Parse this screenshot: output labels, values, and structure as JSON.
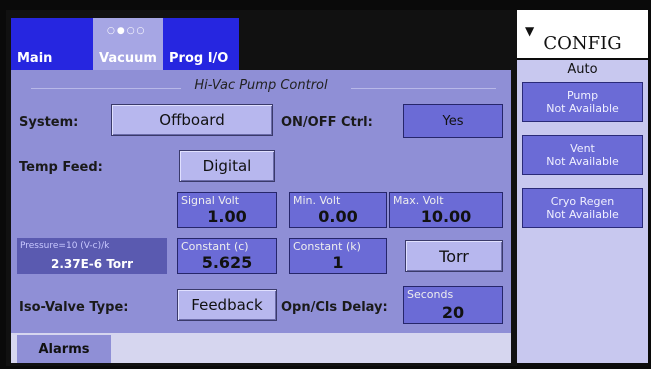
{
  "tabs": [
    {
      "label": "Main"
    },
    {
      "label": "Vacuum",
      "dots": "○●○○"
    },
    {
      "label": "Prog I/O"
    }
  ],
  "section_title": "Hi-Vac Pump Control",
  "system": {
    "label": "System:",
    "value": "Offboard"
  },
  "onoff": {
    "label": "ON/OFF Ctrl:",
    "value": "Yes"
  },
  "temp_feed": {
    "label": "Temp Feed:",
    "value": "Digital"
  },
  "signal_volt": {
    "caption": "Signal Volt",
    "value": "1.00"
  },
  "min_volt": {
    "caption": "Min. Volt",
    "value": "0.00"
  },
  "max_volt": {
    "caption": "Max. Volt",
    "value": "10.00"
  },
  "pressure": {
    "formula": "Pressure=10 (V-c)/k",
    "value": "2.37E-6 Torr"
  },
  "constant_c": {
    "caption": "Constant (c)",
    "value": "5.625"
  },
  "constant_k": {
    "caption": "Constant (k)",
    "value": "1"
  },
  "units": {
    "value": "Torr"
  },
  "iso_valve": {
    "label": "Iso-Valve Type:",
    "value": "Feedback"
  },
  "delay": {
    "label": "Opn/Cls Delay:",
    "caption": "Seconds",
    "value": "20"
  },
  "bottom": {
    "alarms": "Alarms"
  },
  "sidebar": {
    "config": "CONFIG",
    "auto": "Auto",
    "items": [
      {
        "title": "Pump",
        "status": "Not Available"
      },
      {
        "title": "Vent",
        "status": "Not Available"
      },
      {
        "title": "Cryo Regen",
        "status": "Not Available"
      }
    ]
  }
}
